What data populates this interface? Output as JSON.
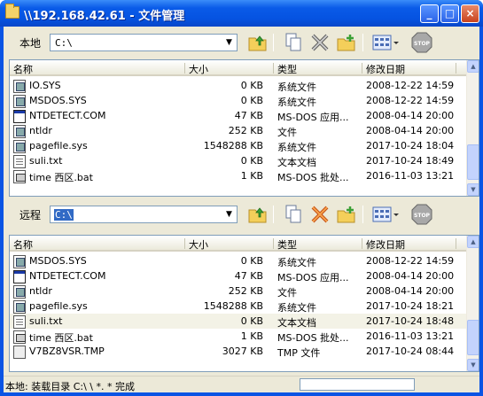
{
  "window": {
    "title": "\\\\192.168.42.61 - 文件管理",
    "minimize": "_",
    "maximize": "□",
    "close": "×"
  },
  "local": {
    "label": "本地",
    "path": "C:\\",
    "columns": [
      "名称",
      "大小",
      "类型",
      "修改日期"
    ],
    "files": [
      {
        "name": "IO.SYS",
        "size": "0 KB",
        "type": "系统文件",
        "date": "2008-12-22 14:59",
        "icon": "sys-file-icon"
      },
      {
        "name": "MSDOS.SYS",
        "size": "0 KB",
        "type": "系统文件",
        "date": "2008-12-22 14:59",
        "icon": "sys-file-icon"
      },
      {
        "name": "NTDETECT.COM",
        "size": "47 KB",
        "type": "MS-DOS 应用...",
        "date": "2008-04-14 20:00",
        "icon": "exe-file-icon"
      },
      {
        "name": "ntldr",
        "size": "252 KB",
        "type": "文件",
        "date": "2008-04-14 20:00",
        "icon": "sys-file-icon"
      },
      {
        "name": "pagefile.sys",
        "size": "1548288 KB",
        "type": "系统文件",
        "date": "2017-10-24 18:04",
        "icon": "sys-file-icon"
      },
      {
        "name": "suli.txt",
        "size": "0 KB",
        "type": "文本文档",
        "date": "2017-10-24 18:49",
        "icon": "txt-file-icon"
      },
      {
        "name": "time 西区.bat",
        "size": "1 KB",
        "type": "MS-DOS 批处...",
        "date": "2016-11-03 13:21",
        "icon": "bat-file-icon"
      }
    ]
  },
  "remote": {
    "label": "远程",
    "path": "C:\\",
    "columns": [
      "名称",
      "大小",
      "类型",
      "修改日期"
    ],
    "files": [
      {
        "name": "MSDOS.SYS",
        "size": "0 KB",
        "type": "系统文件",
        "date": "2008-12-22 14:59",
        "icon": "sys-file-icon"
      },
      {
        "name": "NTDETECT.COM",
        "size": "47 KB",
        "type": "MS-DOS 应用...",
        "date": "2008-04-14 20:00",
        "icon": "exe-file-icon"
      },
      {
        "name": "ntldr",
        "size": "252 KB",
        "type": "文件",
        "date": "2008-04-14 20:00",
        "icon": "sys-file-icon"
      },
      {
        "name": "pagefile.sys",
        "size": "1548288 KB",
        "type": "系统文件",
        "date": "2017-10-24 18:21",
        "icon": "sys-file-icon"
      },
      {
        "name": "suli.txt",
        "size": "0 KB",
        "type": "文本文档",
        "date": "2017-10-24 18:48",
        "icon": "txt-file-icon"
      },
      {
        "name": "time 西区.bat",
        "size": "1 KB",
        "type": "MS-DOS 批处...",
        "date": "2016-11-03 13:21",
        "icon": "bat-file-icon"
      },
      {
        "name": "V7BZ8VSR.TMP",
        "size": "3027 KB",
        "type": "TMP 文件",
        "date": "2017-10-24 08:44",
        "icon": "tmp-file-icon"
      }
    ]
  },
  "status": {
    "text": "本地: 装载目录 C:\\ \\ *. * 完成"
  },
  "colors": {
    "titlebar": "#0a54e4",
    "selection": "#316ac5",
    "client": "#ece9d8"
  }
}
